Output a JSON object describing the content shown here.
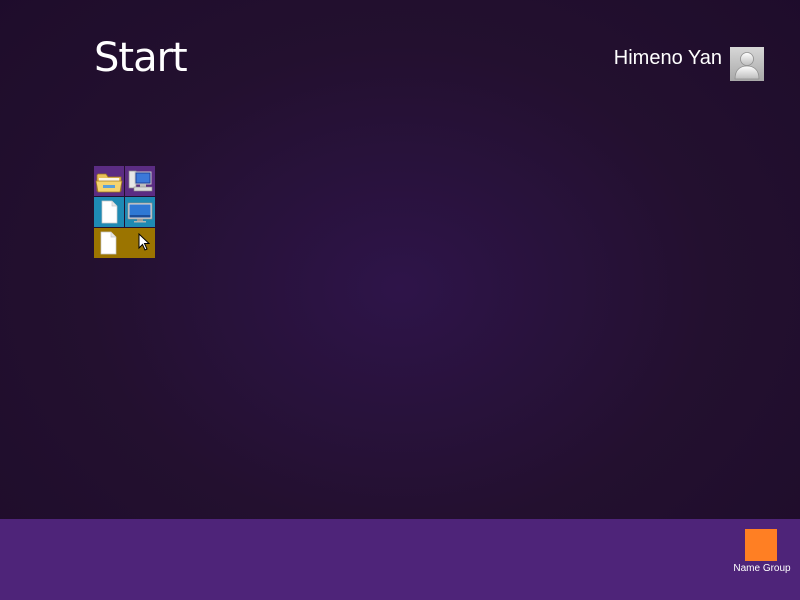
{
  "screen": {
    "title": "Start"
  },
  "user": {
    "name": "Himeno Yan",
    "avatar_icon": "user-avatar-icon"
  },
  "tile_group": {
    "tiles": [
      {
        "icon": "file-explorer-icon",
        "color": "#5b2c83"
      },
      {
        "icon": "computer-icon",
        "color": "#5b2c83"
      },
      {
        "icon": "document-icon",
        "color": "#1e8ab4"
      },
      {
        "icon": "desktop-icon",
        "color": "#1e8ab4"
      },
      {
        "icon": "document-icon",
        "color": "#9b7400"
      }
    ]
  },
  "app_bar": {
    "name_group_label": "Name Group",
    "name_group_icon": "name-group-icon",
    "name_group_icon_color": "#ff7f23"
  },
  "colors": {
    "background": "#23102f",
    "app_bar": "#4e2479",
    "accent": "#ff7f23"
  }
}
